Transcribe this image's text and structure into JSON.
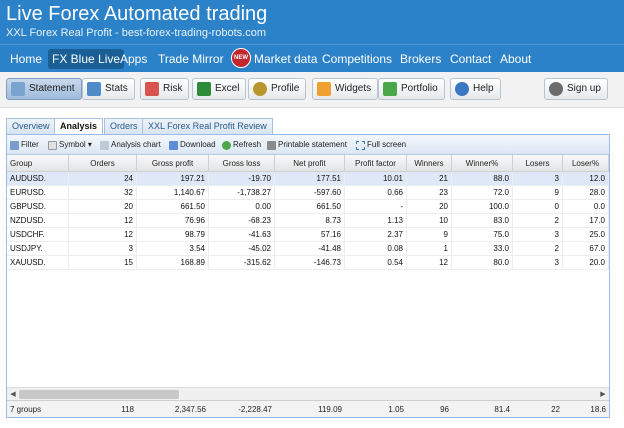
{
  "header": {
    "title": "Live Forex Automated trading",
    "subtitle": "XXL Forex Real Profit - best-forex-trading-robots.com"
  },
  "nav": {
    "items": [
      {
        "label": "Home"
      },
      {
        "label": "FX Blue Live",
        "active": true
      },
      {
        "label": "Apps"
      },
      {
        "label": "Trade Mirror"
      },
      {
        "label": "Market data"
      },
      {
        "label": "Competitions"
      },
      {
        "label": "Brokers"
      },
      {
        "label": "Contact"
      },
      {
        "label": "About"
      }
    ],
    "new_badge": "NEW"
  },
  "toolbar": {
    "statement": "Statement",
    "stats": "Stats",
    "risk": "Risk",
    "excel": "Excel",
    "profile": "Profile",
    "widgets": "Widgets",
    "portfolio": "Portfolio",
    "help": "Help",
    "signup": "Sign up"
  },
  "tabs": [
    {
      "label": "Overview"
    },
    {
      "label": "Analysis",
      "active": true
    },
    {
      "label": "Orders"
    },
    {
      "label": "XXL Forex Real Profit Review"
    }
  ],
  "grid_toolbar": {
    "filter": "Filter",
    "symbol": "Symbol ▾",
    "analysis_chart": "Analysis chart",
    "download": "Download",
    "refresh": "Refresh",
    "printable": "Printable statement",
    "fullscreen": "Full screen"
  },
  "table": {
    "columns": [
      "Group",
      "Orders",
      "Gross profit",
      "Gross loss",
      "Net profit",
      "Profit factor",
      "Winners",
      "Winner%",
      "Losers",
      "Loser%"
    ],
    "rows": [
      [
        "AUDUSD.",
        "24",
        "197.21",
        "-19.70",
        "177.51",
        "10.01",
        "21",
        "88.0",
        "3",
        "12.0"
      ],
      [
        "EURUSD.",
        "32",
        "1,140.67",
        "-1,738.27",
        "-597.60",
        "0.66",
        "23",
        "72.0",
        "9",
        "28.0"
      ],
      [
        "GBPUSD.",
        "20",
        "661.50",
        "0.00",
        "661.50",
        "-",
        "20",
        "100.0",
        "0",
        "0.0"
      ],
      [
        "NZDUSD.",
        "12",
        "76.96",
        "-68.23",
        "8.73",
        "1.13",
        "10",
        "83.0",
        "2",
        "17.0"
      ],
      [
        "USDCHF.",
        "12",
        "98.79",
        "-41.63",
        "57.16",
        "2.37",
        "9",
        "75.0",
        "3",
        "25.0"
      ],
      [
        "USDJPY.",
        "3",
        "3.54",
        "-45.02",
        "-41.48",
        "0.08",
        "1",
        "33.0",
        "2",
        "67.0"
      ],
      [
        "XAUUSD.",
        "15",
        "168.89",
        "-315.62",
        "-146.73",
        "0.54",
        "12",
        "80.0",
        "3",
        "20.0"
      ]
    ],
    "selected_row": 0,
    "summary": [
      "7 groups",
      "118",
      "2,347.56",
      "-2,228.47",
      "119.09",
      "1.05",
      "96",
      "81.4",
      "22",
      "18.6"
    ]
  },
  "colors": {
    "brand_blue": "#2c82c9",
    "selected_row": "#dfe8f6"
  }
}
